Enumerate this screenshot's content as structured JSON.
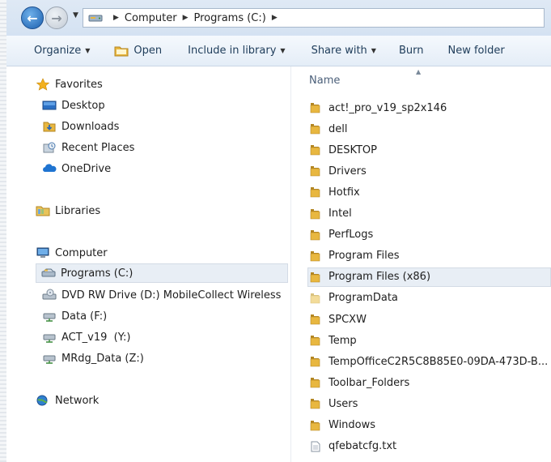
{
  "address": {
    "crumbs": [
      "Computer",
      "Programs (C:)"
    ]
  },
  "toolbar": {
    "organize": "Organize",
    "open": "Open",
    "include_in_library": "Include in library",
    "share_with": "Share with",
    "burn": "Burn",
    "new_folder": "New folder"
  },
  "nav": {
    "favorites": "Favorites",
    "desktop": "Desktop",
    "downloads": "Downloads",
    "recent_places": "Recent Places",
    "onedrive": "OneDrive",
    "libraries": "Libraries",
    "computer": "Computer",
    "programs_c": "Programs (C:)",
    "dvd_drive": "DVD RW Drive (D:) MobileCollect Wireless",
    "data_f": "Data (F:)",
    "act_y": "ACT_v19  (Y:)",
    "mrdg_z": "MRdg_Data (Z:)",
    "network": "Network"
  },
  "content": {
    "column_name": "Name",
    "files": [
      {
        "name": "act!_pro_v19_sp2x146",
        "type": "folder"
      },
      {
        "name": "dell",
        "type": "folder"
      },
      {
        "name": "DESKTOP",
        "type": "folder"
      },
      {
        "name": "Drivers",
        "type": "folder"
      },
      {
        "name": "Hotfix",
        "type": "folder"
      },
      {
        "name": "Intel",
        "type": "folder"
      },
      {
        "name": "PerfLogs",
        "type": "folder"
      },
      {
        "name": "Program Files",
        "type": "folder"
      },
      {
        "name": "Program Files (x86)",
        "type": "folder",
        "selected": true
      },
      {
        "name": "ProgramData",
        "type": "folder-hidden"
      },
      {
        "name": "SPCXW",
        "type": "folder"
      },
      {
        "name": "Temp",
        "type": "folder"
      },
      {
        "name": "TempOfficeC2R5C8B85E0-09DA-473D-B...",
        "type": "folder"
      },
      {
        "name": "Toolbar_Folders",
        "type": "folder"
      },
      {
        "name": "Users",
        "type": "folder"
      },
      {
        "name": "Windows",
        "type": "folder"
      },
      {
        "name": "qfebatcfg.txt",
        "type": "text-file"
      }
    ]
  },
  "colors": {
    "folder": "#e8b740",
    "selection": "#e8eef5",
    "header_text": "#4c607a",
    "accent_blue": "#1b5fae"
  }
}
